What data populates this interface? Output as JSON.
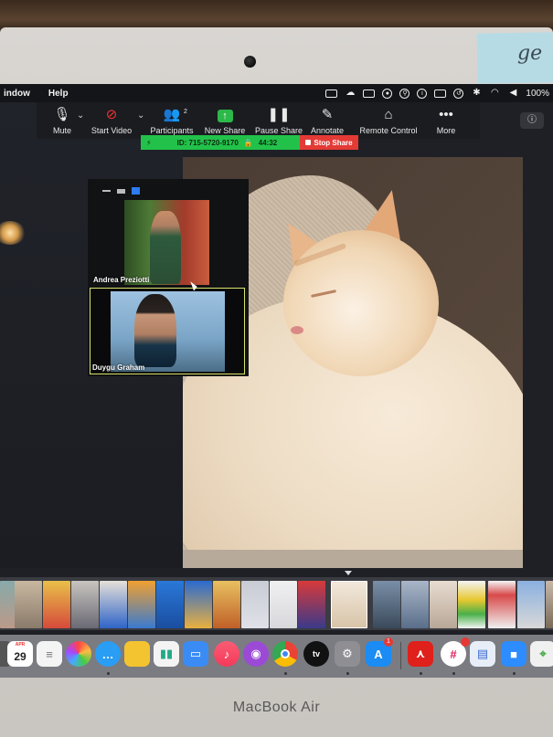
{
  "menubar": {
    "items": [
      "indow",
      "Help"
    ],
    "battery": "100%"
  },
  "toolbar": {
    "buttons": [
      {
        "label": "Mute",
        "glyph": "🎤"
      },
      {
        "label": "Start Video",
        "glyph": "▰"
      },
      {
        "label": "Participants",
        "glyph": "👥",
        "count": "2"
      },
      {
        "label": "New Share",
        "glyph": "↑"
      },
      {
        "label": "Pause Share",
        "glyph": "❚❚"
      },
      {
        "label": "Annotate",
        "glyph": "✎"
      },
      {
        "label": "Remote Control",
        "glyph": "🖱"
      },
      {
        "label": "More",
        "glyph": "•••"
      }
    ]
  },
  "sharebar": {
    "meeting_id": "ID: 715-5720-9170",
    "timer": "44:32",
    "stop_label": "Stop Share"
  },
  "video": {
    "participants": [
      {
        "name": "Andrea Preziotti"
      },
      {
        "name": "Duygu Graham"
      }
    ]
  },
  "dock": {
    "calendar_month": "APR",
    "calendar_day": "29",
    "appstore_badge": "1"
  },
  "sticky_note": "ge",
  "brand": "MacBook Air",
  "colors": {
    "share_green": "#22c24a",
    "share_red": "#e33a36",
    "active_tile_border": "#d8e36a"
  }
}
